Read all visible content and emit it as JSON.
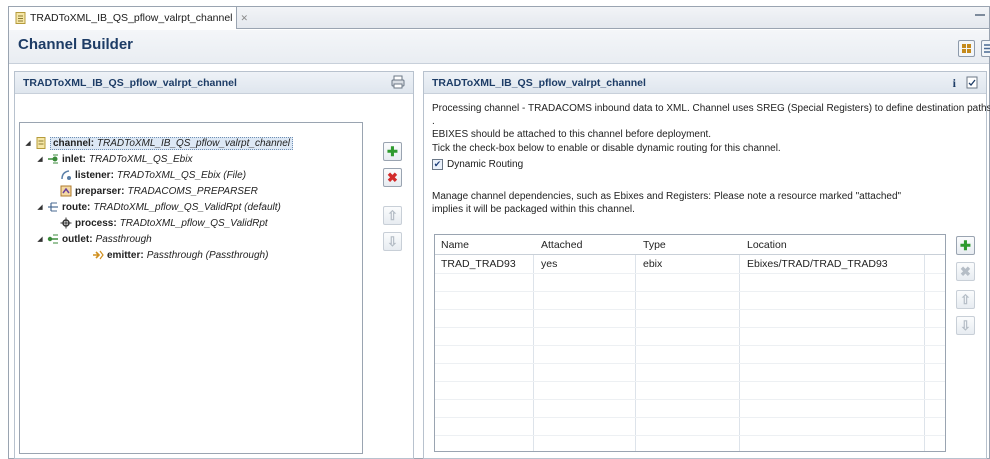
{
  "tab": {
    "title": "TRADToXML_IB_QS_pflow_valrpt_channel",
    "close": "✕"
  },
  "header": {
    "title": "Channel Builder"
  },
  "left_panel": {
    "title": "TRADToXML_IB_QS_pflow_valrpt_channel",
    "tree": [
      {
        "key": "channel:",
        "value": "TRADToXML_IB_QS_pflow_valrpt_channel",
        "icon": "channel-icon"
      },
      {
        "key": "inlet:",
        "value": "TRADToXML_QS_Ebix",
        "icon": "inlet-icon"
      },
      {
        "key": "listener:",
        "value": "TRADToXML_QS_Ebix (File)",
        "icon": "listener-icon"
      },
      {
        "key": "preparser:",
        "value": "TRADACOMS_PREPARSER",
        "icon": "preparser-icon"
      },
      {
        "key": "route:",
        "value": "TRADtoXML_pflow_QS_ValidRpt (default)",
        "icon": "route-icon"
      },
      {
        "key": "process:",
        "value": "TRADtoXML_pflow_QS_ValidRpt",
        "icon": "process-icon"
      },
      {
        "key": "outlet:",
        "value": "Passthrough",
        "icon": "outlet-icon"
      },
      {
        "key": "emitter:",
        "value": "Passthrough (Passthrough)",
        "icon": "emitter-icon"
      }
    ]
  },
  "right_panel": {
    "title": "TRADToXML_IB_QS_pflow_valrpt_channel",
    "info_glyph": "i",
    "description_line1": "Processing channel - TRADACOMS inbound data to XML. Channel uses SREG (Special Registers) to define destination paths .",
    "description_line2": "EBIXES should be attached to this channel before deployment.",
    "routing_hint": "Tick the check-box below to enable or disable dynamic routing for this channel.",
    "dynamic_routing": {
      "label": "Dynamic Routing",
      "checked": true
    },
    "dependencies_hint_line1": "Manage channel dependencies, such as Ebixes and Registers: Please note a resource marked \"attached\"",
    "dependencies_hint_line2": "implies it will be packaged within this channel.",
    "table": {
      "columns": [
        "Name",
        "Attached",
        "Type",
        "Location"
      ],
      "rows": [
        [
          "TRAD_TRAD93",
          "yes",
          "ebix",
          "Ebixes/TRAD/TRAD_TRAD93"
        ]
      ]
    }
  },
  "colors": {
    "accent": "#1d3c66",
    "add": "#2e9a2e",
    "remove": "#d22b2b"
  }
}
